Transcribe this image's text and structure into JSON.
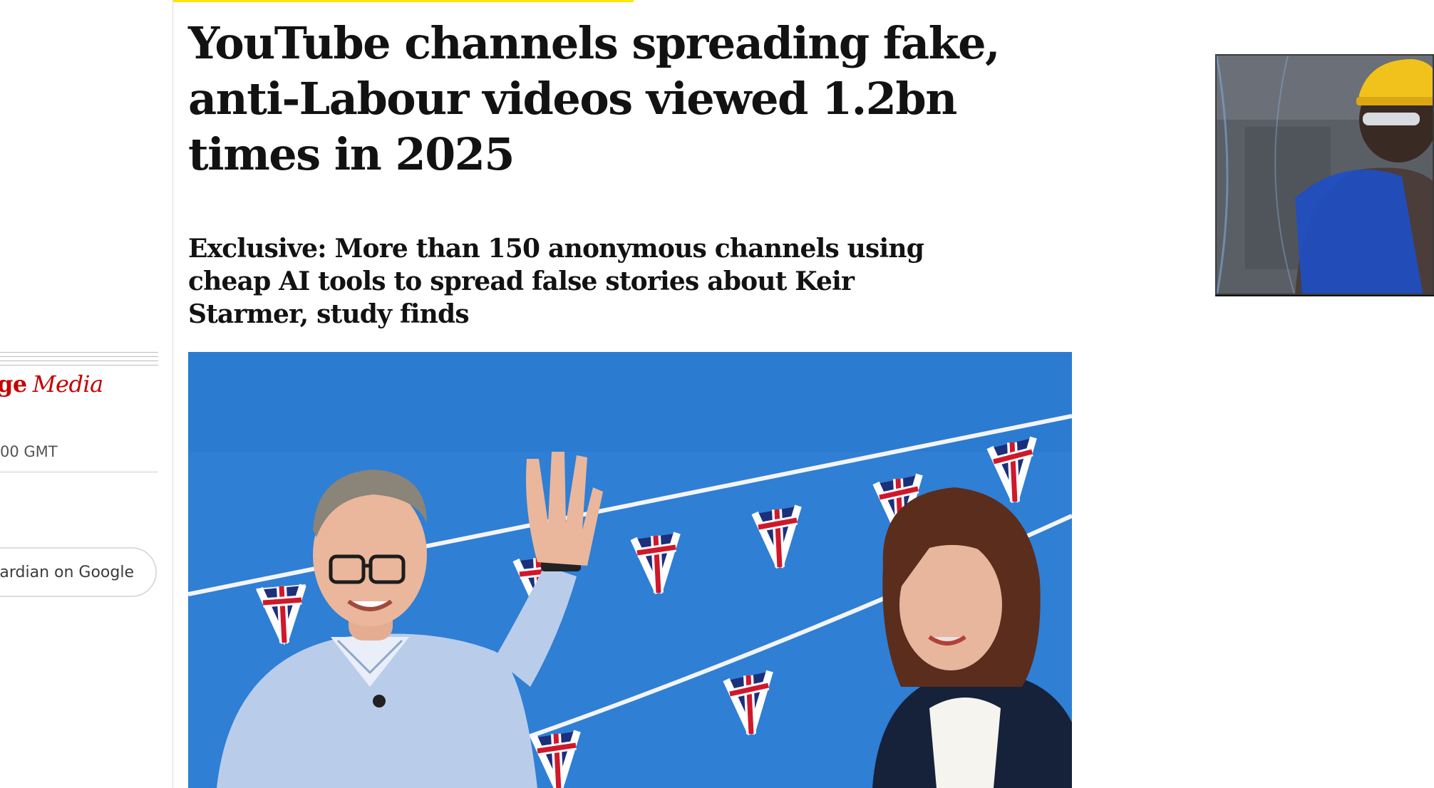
{
  "article": {
    "headline": "YouTube channels spreading fake, anti-Labour videos viewed 1.2bn times in 2025",
    "standfirst": "Exclusive: More than 150 anonymous channels using cheap AI tools to spread false stories about Keir Starmer, study finds"
  },
  "sidebar": {
    "section_label": "ge",
    "section_sub": "Media",
    "dateline": "00 GMT",
    "google_button_label": "uardian on Google"
  },
  "colors": {
    "section_red": "#c70000",
    "kicker_yellow": "#ffe500",
    "image_sky_blue": "#2f7fd4"
  },
  "icons": {
    "main_image": "photo-starmer-reeves-bunting",
    "side_thumbnail": "photo-worker-hard-hat"
  }
}
